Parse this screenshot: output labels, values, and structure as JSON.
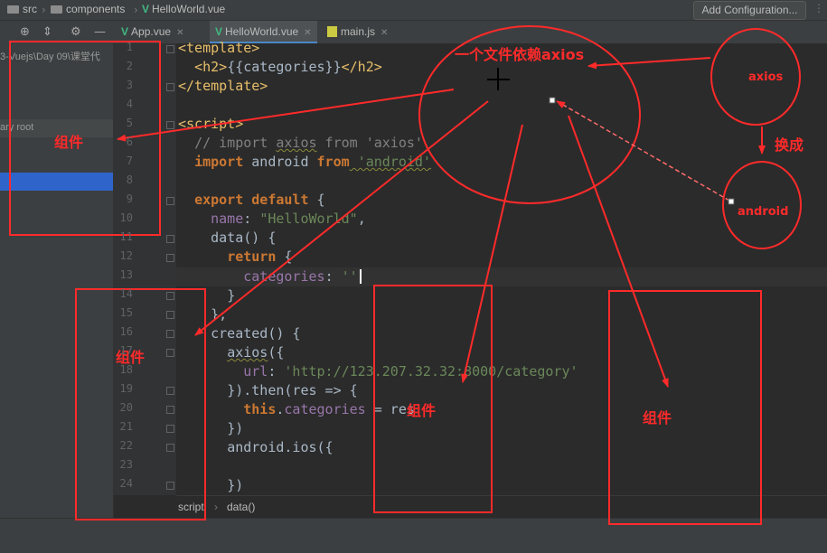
{
  "topbar": {
    "crumbs": [
      "src",
      "components",
      "HelloWorld.vue"
    ],
    "add_config": "Add Configuration..."
  },
  "tabs": [
    {
      "label": "App.vue",
      "icon": "vue-icon"
    },
    {
      "label": "HelloWorld.vue",
      "icon": "vue-icon",
      "active": true
    },
    {
      "label": "main.js",
      "icon": "js-icon"
    }
  ],
  "project": {
    "path_text": "3-Vuejs\\Day 09\\课堂代",
    "root_text": "ary root"
  },
  "editor": {
    "line_numbers": [
      "1",
      "2",
      "3",
      "4",
      "5",
      "6",
      "7",
      "8",
      "9",
      "10",
      "11",
      "12",
      "13",
      "14",
      "15",
      "16",
      "17",
      "18",
      "19",
      "20",
      "21",
      "22",
      "23",
      "24"
    ],
    "lines": {
      "l1": "<template>",
      "l2a": "<h2>",
      "l2b": "{{categories}}",
      "l2c": "</h2>",
      "l3": "</template>",
      "l5": "<script>",
      "l6a": "// import ",
      "l6b": "axios",
      "l6c": " from ",
      "l6d": "'axios'",
      "l7a": "import",
      "l7b": " android ",
      "l7c": "from",
      "l7d": " 'android'",
      "l9a": "export default",
      "l9b": " {",
      "l10a": "name",
      "l10b": ": ",
      "l10c": "\"HelloWorld\"",
      "l10d": ",",
      "l11": "data() {",
      "l12a": "return",
      "l12b": " {",
      "l13a": "categories",
      "l13b": ": ",
      "l13c": "''",
      "l14": "}",
      "l15": "},",
      "l16": "created() {",
      "l17a": "axios",
      "l17b": "({",
      "l18a": "url",
      "l18b": ": ",
      "l18c": "'http://123.207.32.32:8000/category'",
      "l19": "}).then(res => {",
      "l20a": "this",
      "l20b": ".",
      "l20c": "categories",
      "l20d": " = res",
      "l21": "})",
      "l22": "android.ios({",
      "l24": "})"
    }
  },
  "breadcrumb": [
    "script",
    "data()"
  ],
  "annotations": {
    "top_note": "一个文件依赖axios",
    "axios": "axios",
    "replace": "换成",
    "android": "android",
    "component": "组件"
  },
  "colors": {
    "annotation": "#ff2a2a",
    "vue": "#41b883",
    "tab_active_border": "#4a88c7"
  }
}
